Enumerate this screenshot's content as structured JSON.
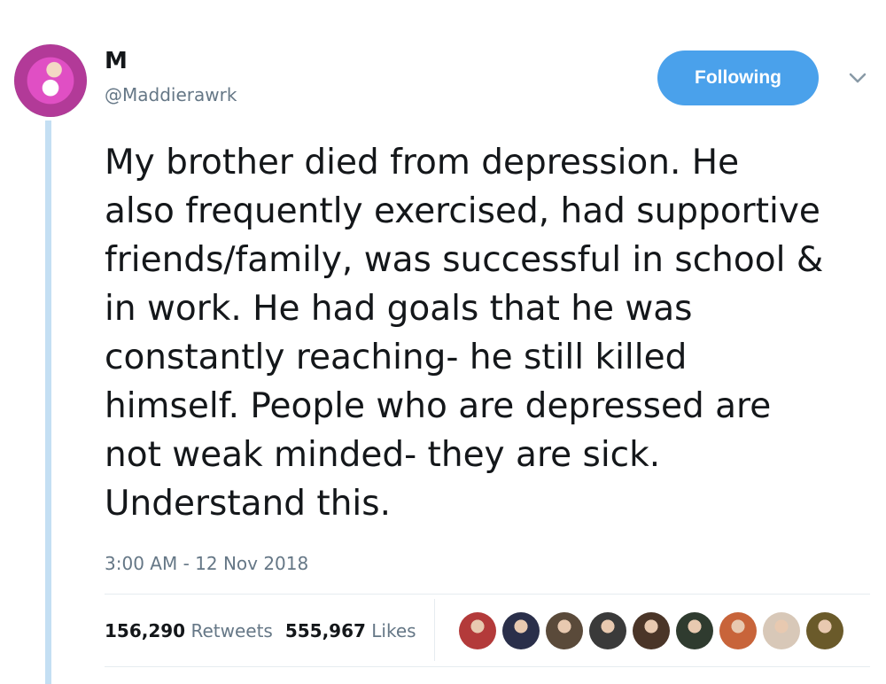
{
  "user": {
    "display_name": "M",
    "handle": "@Maddierawrk"
  },
  "follow_button": {
    "label": "Following",
    "color": "#4aa1eb"
  },
  "tweet": {
    "lines": [
      "My brother died from depression. He",
      "also frequently exercised, had supportive",
      "friends/family, was successful in school &",
      "in work. He had goals that he was",
      "constantly reaching- he still killed",
      "himself. People who are depressed are",
      "not weak minded- they are sick.",
      "Understand this."
    ],
    "timestamp": "3:00 AM - 12 Nov 2018"
  },
  "stats": {
    "retweets_count": "156,290",
    "retweets_label": "Retweets",
    "likes_count": "555,967",
    "likes_label": "Likes"
  },
  "likers": [
    {
      "icon": "liker-avatar-1",
      "color": "#b33a3a"
    },
    {
      "icon": "liker-avatar-2",
      "color": "#2a2f4a"
    },
    {
      "icon": "liker-avatar-3",
      "color": "#5a4a3a"
    },
    {
      "icon": "liker-avatar-4",
      "color": "#3a3a3a"
    },
    {
      "icon": "liker-avatar-5",
      "color": "#4a3528"
    },
    {
      "icon": "liker-avatar-6",
      "color": "#2f3b2f"
    },
    {
      "icon": "liker-avatar-7",
      "color": "#c8643a"
    },
    {
      "icon": "liker-avatar-8",
      "color": "#d8c8b8"
    },
    {
      "icon": "liker-avatar-9",
      "color": "#6a5a2a"
    }
  ],
  "colors": {
    "thread_line": "#c4dff3",
    "secondary_text": "#657786",
    "primary_text": "#14171a"
  }
}
